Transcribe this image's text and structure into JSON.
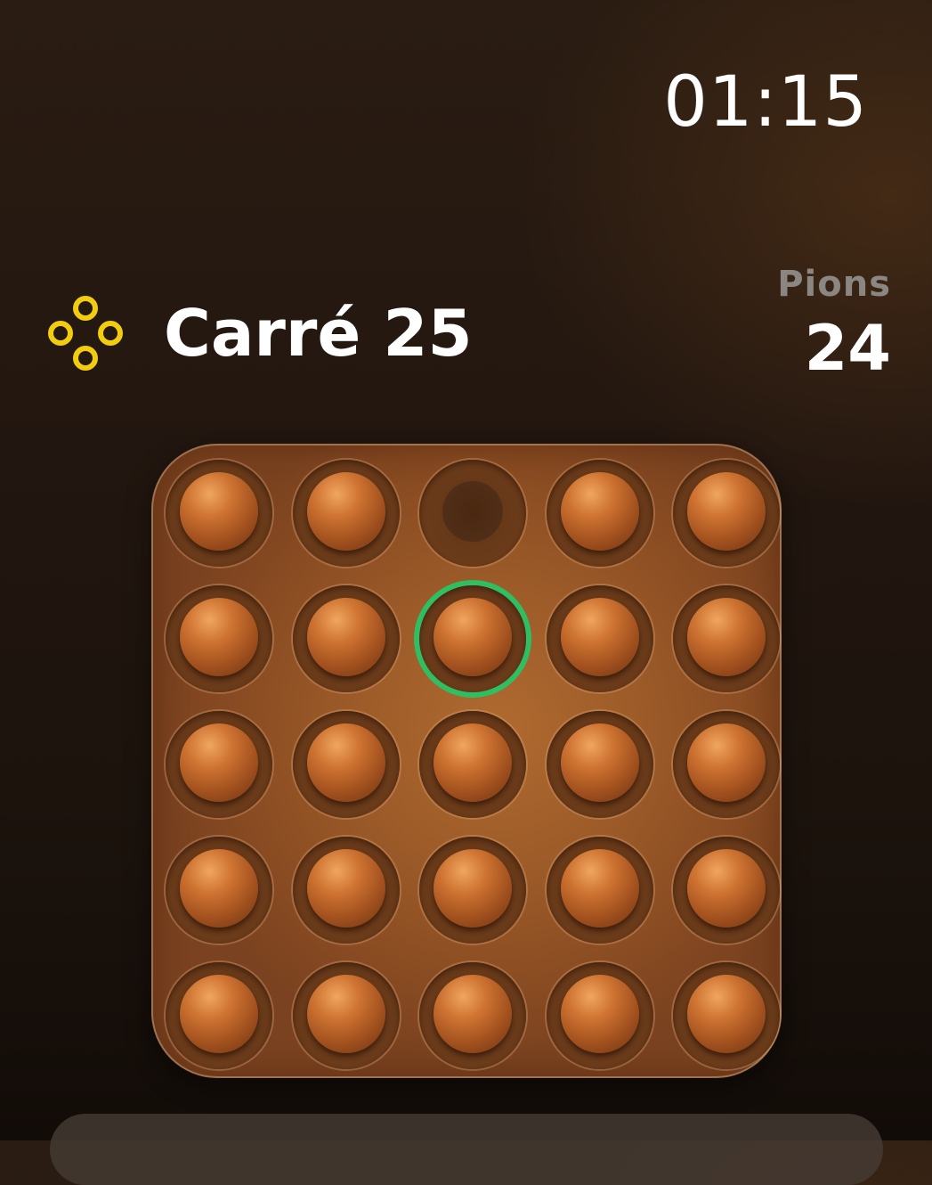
{
  "timer": "01:15",
  "level": {
    "icon": "four-circles-icon",
    "title": "Carré 25"
  },
  "counter": {
    "label": "Pions",
    "value": "24"
  },
  "colors": {
    "accent_icon": "#f2cc0f",
    "selection_ring": "#2fbf63",
    "board": "#9b5a28",
    "peg": "#cf7432"
  },
  "board": {
    "rows": 5,
    "cols": 5,
    "cells": [
      [
        "peg",
        "peg",
        "empty",
        "peg",
        "peg"
      ],
      [
        "peg",
        "peg",
        "peg-selected",
        "peg",
        "peg"
      ],
      [
        "peg",
        "peg",
        "peg",
        "peg",
        "peg"
      ],
      [
        "peg",
        "peg",
        "peg",
        "peg",
        "peg"
      ],
      [
        "peg",
        "peg",
        "peg",
        "peg",
        "peg"
      ]
    ]
  }
}
